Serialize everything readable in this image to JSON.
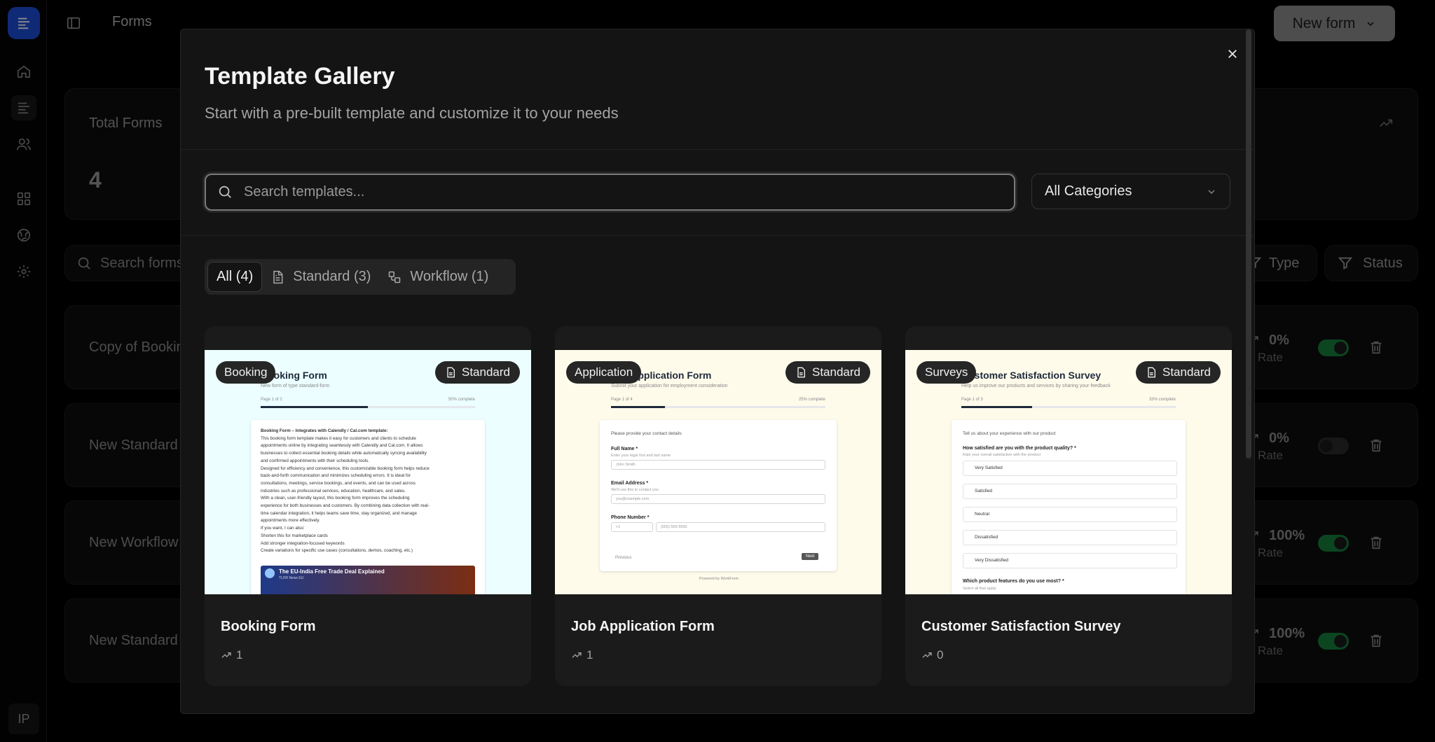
{
  "app": {
    "avatar_initials": "IP",
    "topbar_title": "Forms",
    "new_form_label": "New form"
  },
  "dashboard": {
    "total_forms_label": "Total Forms",
    "total_forms_value": "4",
    "search_placeholder": "Search forms...",
    "type_filter": "Type",
    "status_filter": "Status",
    "rate_label": "Rate",
    "rows": [
      {
        "name": "Copy of Booking Form",
        "rate": "0%",
        "enabled": true
      },
      {
        "name": "New Standard Form",
        "rate": "0%",
        "enabled": false
      },
      {
        "name": "New Workflow Form",
        "rate": "100%",
        "enabled": true
      },
      {
        "name": "New Standard Form",
        "rate": "100%",
        "enabled": true
      }
    ]
  },
  "modal": {
    "title": "Template Gallery",
    "subtitle": "Start with a pre-built template and customize it to your needs",
    "search_placeholder": "Search templates...",
    "category_select": "All Categories",
    "tabs": [
      {
        "label": "All (4)",
        "active": true
      },
      {
        "label": "Standard (3)",
        "active": false
      },
      {
        "label": "Workflow (1)",
        "active": false
      }
    ],
    "templates": [
      {
        "name": "Booking Form",
        "category": "Booking",
        "type": "Standard",
        "uses": "1"
      },
      {
        "name": "Job Application Form",
        "category": "Application",
        "type": "Standard",
        "uses": "1"
      },
      {
        "name": "Customer Satisfaction Survey",
        "category": "Surveys",
        "type": "Standard",
        "uses": "0"
      }
    ]
  },
  "previews": {
    "booking": {
      "title": "Booking Form",
      "subtitle": "New form of type standard-form",
      "page": "Page 1 of 2",
      "percent": "50% complete",
      "progress": 0.5,
      "lines": [
        "Booking Form – Integrates with Calendly / Cal.com template:",
        "This booking form template makes it easy for customers and clients to schedule",
        "appointments online by integrating seamlessly with Calendly and Cal.com. It allows",
        "businesses to collect essential booking details while automatically syncing availability",
        "and confirmed appointments with their scheduling tools.",
        "Designed for efficiency and convenience, this customizable booking form helps reduce",
        "back-and-forth communication and minimizes scheduling errors. It is ideal for",
        "consultations, meetings, service bookings, and events, and can be used across",
        "industries such as professional services, education, healthcare, and sales.",
        "With a clean, user-friendly layout, this booking form improves the scheduling",
        "experience for both businesses and customers. By combining data collection with real-",
        "time calendar integration, it helps teams save time, stay organized, and manage",
        "appointments more effectively.",
        "If you want, I can also:",
        "Shorten this for marketplace cards",
        "Add stronger integration-focused keywords",
        "Create variations for specific use cases (consultations, demos, coaching, etc.)"
      ],
      "video_title": "The EU-India Free Trade Deal Explained",
      "video_channel": "TLDR News EU"
    },
    "job": {
      "title": "Job Application Form",
      "subtitle": "Submit your application for employment consideration",
      "page": "Page 1 of 4",
      "percent": "25% complete",
      "progress": 0.25,
      "intro": "Please provide your contact details",
      "fields": [
        {
          "label": "Full Name *",
          "hint": "Enter your legal first and last name",
          "placeholder": "John Smith"
        },
        {
          "label": "Email Address *",
          "hint": "We'll use this to contact you",
          "placeholder": "you@example.com"
        },
        {
          "label": "Phone Number *",
          "hint": "",
          "placeholder": "(555) 555-5555"
        }
      ],
      "phone_code": "+1",
      "previous": "Previous",
      "next": "Next",
      "powered": "Powered by WorkForm"
    },
    "survey": {
      "title": "Customer Satisfaction Survey",
      "subtitle": "Help us improve our products and services by sharing your feedback",
      "page": "Page 1 of 3",
      "percent": "33% complete",
      "progress": 0.33,
      "intro": "Tell us about your experience with our product",
      "question": "How satisfied are you with the product quality? *",
      "question_hint": "Rate your overall satisfaction with the product",
      "options": [
        "Very Satisfied",
        "Satisfied",
        "Neutral",
        "Dissatisfied",
        "Very Dissatisfied"
      ],
      "question2": "Which product features do you use most? *",
      "question2_hint": "Select all that apply"
    }
  },
  "colors": {
    "accent": "#1d4ed8",
    "toggle_on": "#15803d",
    "booking_bg": "#ecfeff",
    "form_bg": "#fffbeb"
  }
}
